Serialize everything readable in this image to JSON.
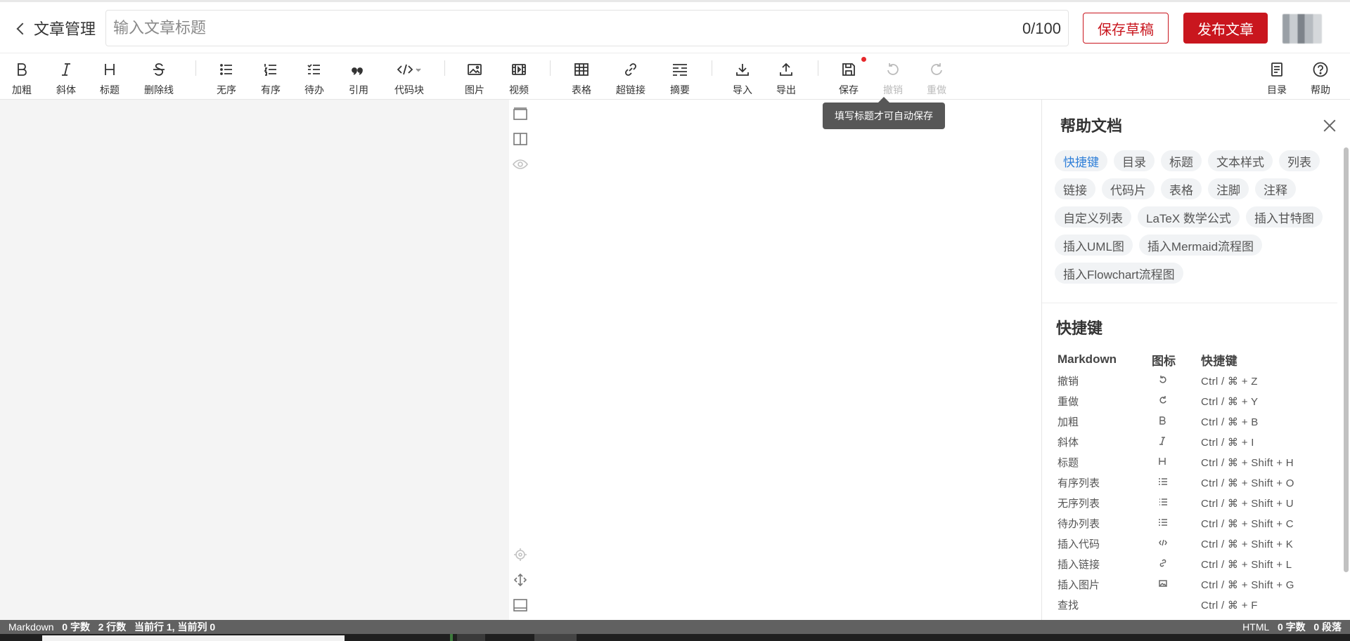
{
  "header": {
    "back_label": "文章管理",
    "title_placeholder": "输入文章标题",
    "title_value": "",
    "title_count": "0/100",
    "save_draft_label": "保存草稿",
    "publish_label": "发布文章"
  },
  "toolbar": {
    "bold": "加粗",
    "italic": "斜体",
    "heading": "标题",
    "strike": "删除线",
    "ul": "无序",
    "ol": "有序",
    "todo": "待办",
    "quote": "引用",
    "code": "代码块",
    "image": "图片",
    "video": "视频",
    "table": "表格",
    "link": "超链接",
    "summary": "摘要",
    "import": "导入",
    "export": "导出",
    "save": "保存",
    "undo": "撤销",
    "redo": "重做",
    "toc": "目录",
    "help": "帮助"
  },
  "tooltip": "填写标题才可自动保存",
  "help": {
    "title": "帮助文档",
    "tags": [
      "快捷键",
      "目录",
      "标题",
      "文本样式",
      "列表",
      "链接",
      "代码片",
      "表格",
      "注脚",
      "注释",
      "自定义列表",
      "LaTeX 数学公式",
      "插入甘特图",
      "插入UML图",
      "插入Mermaid流程图",
      "插入Flowchart流程图"
    ],
    "active_tag": "快捷键",
    "shortcuts_title": "快捷键",
    "columns": [
      "Markdown",
      "图标",
      "快捷键"
    ],
    "rows": [
      {
        "name": "撤销",
        "icon": "undo-icon",
        "keys": "Ctrl / ⌘ + Z"
      },
      {
        "name": "重做",
        "icon": "redo-icon",
        "keys": "Ctrl / ⌘ + Y"
      },
      {
        "name": "加粗",
        "icon": "bold-icon",
        "keys": "Ctrl / ⌘ + B"
      },
      {
        "name": "斜体",
        "icon": "italic-icon",
        "keys": "Ctrl / ⌘ + I"
      },
      {
        "name": "标题",
        "icon": "heading-icon",
        "keys": "Ctrl / ⌘ + Shift + H"
      },
      {
        "name": "有序列表",
        "icon": "ordered-list-icon",
        "keys": "Ctrl / ⌘ + Shift + O"
      },
      {
        "name": "无序列表",
        "icon": "unordered-list-icon",
        "keys": "Ctrl / ⌘ + Shift + U"
      },
      {
        "name": "待办列表",
        "icon": "todo-list-icon",
        "keys": "Ctrl / ⌘ + Shift + C"
      },
      {
        "name": "插入代码",
        "icon": "code-icon",
        "keys": "Ctrl / ⌘ + Shift + K"
      },
      {
        "name": "插入链接",
        "icon": "link-icon",
        "keys": "Ctrl / ⌘ + Shift + L"
      },
      {
        "name": "插入图片",
        "icon": "image-icon",
        "keys": "Ctrl / ⌘ + Shift + G"
      },
      {
        "name": "查找",
        "icon": "",
        "keys": "Ctrl / ⌘ + F"
      }
    ]
  },
  "status": {
    "mode": "Markdown",
    "words": "0 字数",
    "lines": "2 行数",
    "cursor": "当前行 1, 当前列 0",
    "right_mode": "HTML",
    "right_words": "0 字数",
    "paragraphs": "0 段落"
  },
  "colors": {
    "brand_red": "#c9161e",
    "tag_active": "#2f7fd8",
    "status_bar": "#616161"
  }
}
